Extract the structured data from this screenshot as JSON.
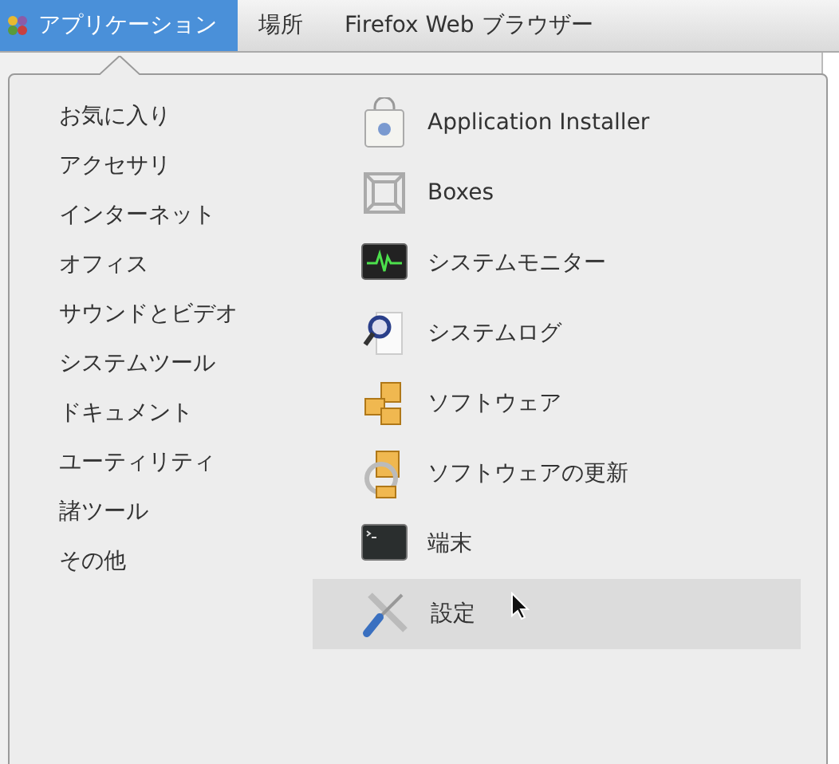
{
  "top_bar": {
    "items": [
      {
        "label": "アプリケーション",
        "selected": true
      },
      {
        "label": "場所",
        "selected": false
      },
      {
        "label": "Firefox Web ブラウザー",
        "selected": false
      }
    ]
  },
  "menu": {
    "categories": [
      {
        "label": "お気に入り"
      },
      {
        "label": "アクセサリ"
      },
      {
        "label": "インターネット"
      },
      {
        "label": "オフィス"
      },
      {
        "label": "サウンドとビデオ"
      },
      {
        "label": "システムツール"
      },
      {
        "label": "ドキュメント"
      },
      {
        "label": "ユーティリティ"
      },
      {
        "label": "諸ツール"
      },
      {
        "label": "その他"
      }
    ],
    "apps": [
      {
        "label": "Application Installer",
        "kind": "installer",
        "selected": false
      },
      {
        "label": "Boxes",
        "kind": "boxes",
        "selected": false
      },
      {
        "label": "システムモニター",
        "kind": "monitor",
        "selected": false
      },
      {
        "label": "システムログ",
        "kind": "log",
        "selected": false
      },
      {
        "label": "ソフトウェア",
        "kind": "software",
        "selected": false
      },
      {
        "label": "ソフトウェアの更新",
        "kind": "update",
        "selected": false
      },
      {
        "label": "端末",
        "kind": "terminal",
        "selected": false
      },
      {
        "label": "設定",
        "kind": "settings",
        "selected": true
      }
    ]
  }
}
